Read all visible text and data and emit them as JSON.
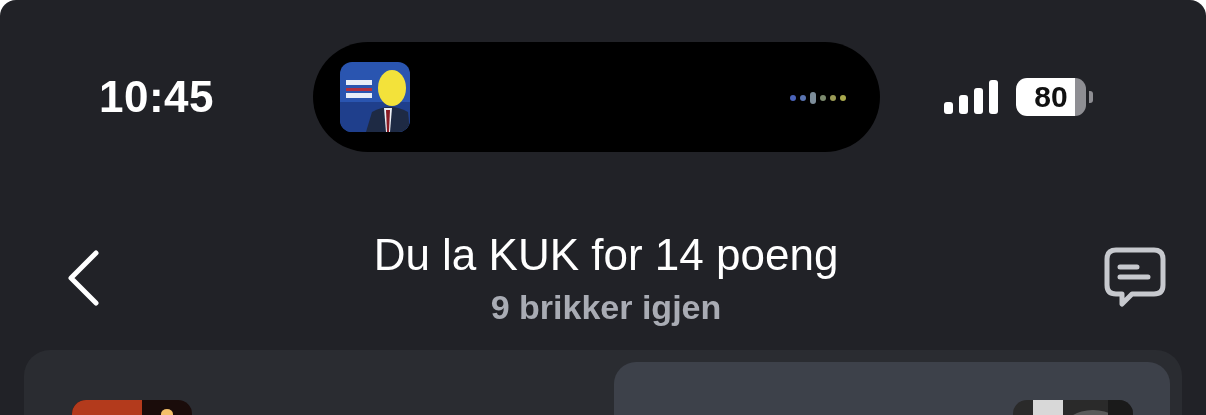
{
  "status_bar": {
    "time": "10:45",
    "battery": "80"
  },
  "header": {
    "title": "Du la KUK for 14 poeng",
    "subtitle": "9 brikker igjen"
  },
  "cards": [
    {
      "selected": false
    },
    {
      "selected": true
    }
  ]
}
